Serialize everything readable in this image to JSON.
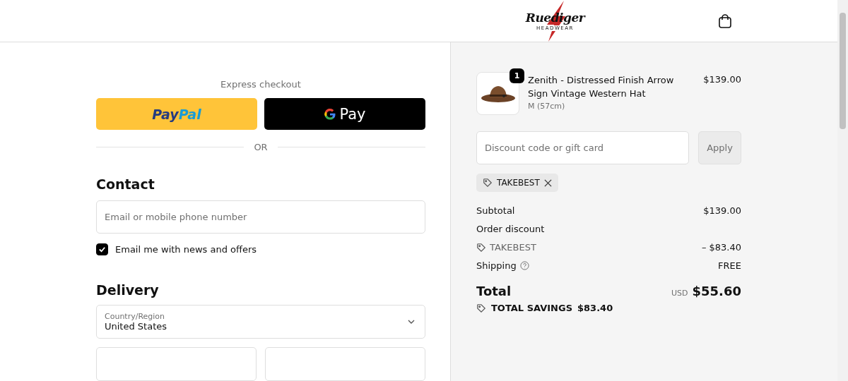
{
  "header": {
    "logo": {
      "name": "Ruediger",
      "tagline": "HEADWEAR"
    }
  },
  "express_checkout": {
    "title": "Express checkout",
    "buttons": [
      {
        "kind": "paypal",
        "label": "PayPal"
      },
      {
        "kind": "gpay",
        "label": "Pay"
      }
    ],
    "divider": "OR"
  },
  "contact": {
    "title": "Contact",
    "email": {
      "placeholder": "Email or mobile phone number"
    },
    "newsletter": {
      "label": "Email me with news and offers",
      "checked": true
    }
  },
  "delivery": {
    "title": "Delivery",
    "country": {
      "label": "Country/Region",
      "value": "United States"
    }
  },
  "cart": {
    "items": [
      {
        "quantity": "1",
        "name": "Zenith - Distressed Finish Arrow Sign Vintage Western Hat",
        "variant": "M (57cm)",
        "price": "$139.00"
      }
    ],
    "discount": {
      "placeholder": "Discount code or gift card",
      "button": "Apply",
      "applied": [
        {
          "code": "TAKEBEST"
        }
      ]
    },
    "lines": [
      {
        "kind": "plain",
        "label": "Subtotal",
        "value": "$139.00"
      },
      {
        "kind": "heading",
        "label": "Order discount"
      },
      {
        "kind": "code",
        "label": "TAKEBEST",
        "value": "– $83.40"
      },
      {
        "kind": "help",
        "label": "Shipping",
        "value": "FREE"
      }
    ],
    "total": {
      "label": "Total",
      "currency": "USD",
      "value": "$55.60"
    },
    "savings": {
      "label": "TOTAL SAVINGS",
      "value": "$83.40"
    }
  }
}
